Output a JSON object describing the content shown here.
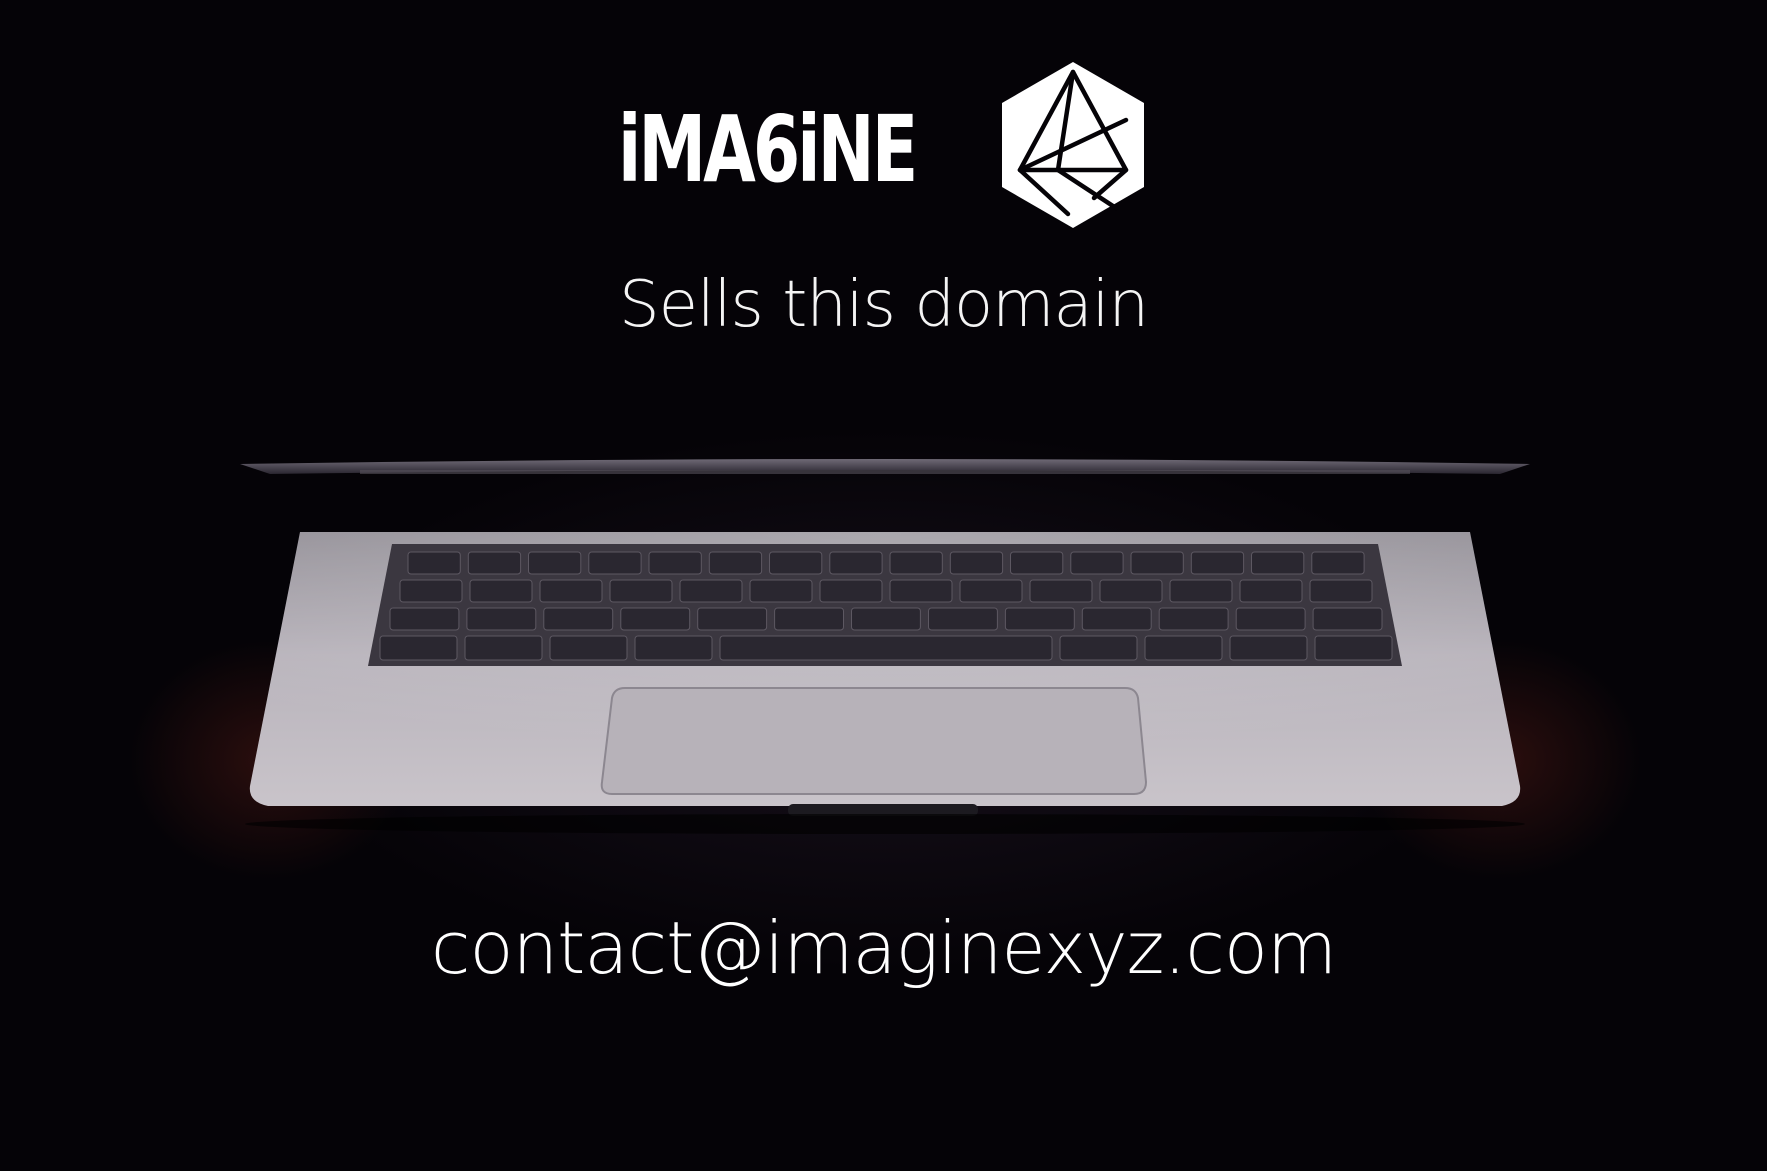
{
  "brand": {
    "wordmark": "iMA6iNE",
    "logo_icon": "geometric-hexagon-icon"
  },
  "tagline": "Sells this domain",
  "contact": {
    "email": "contact@imaginexyz.com"
  },
  "illustration": {
    "subject": "laptop-icon"
  },
  "colors": {
    "background": "#050307",
    "text": "#ffffff",
    "laptop_body": "#b9b4bb",
    "keys": "#2a2730"
  }
}
